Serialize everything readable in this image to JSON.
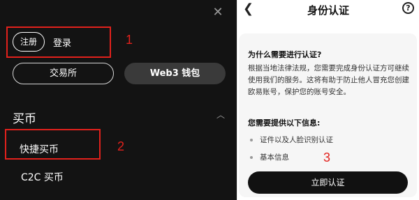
{
  "left_panel": {
    "close_glyph": "✕",
    "register_label": "注册",
    "login_label": "登录",
    "exchange_button": "交易所",
    "wallet_button": "Web3 钱包",
    "section_title": "买币",
    "chevron_glyph": "︿",
    "menu_items": [
      "快捷买币",
      "C2C 买币"
    ]
  },
  "annotations": [
    "1",
    "2",
    "3"
  ],
  "right_panel": {
    "back_glyph": "❮",
    "title": "身份认证",
    "help_glyph": "?",
    "question_title": "为什么需要进行认证?",
    "question_body": "根据当地法律法规，您需要完成身份认证方可继续使用我们的服务。这将有助于防止他人冒充您创建欧易账号，保护您的账号安全。",
    "info_title": "您需要提供以下信息:",
    "info_items": [
      "证件以及人脸识别认证",
      "基本信息"
    ],
    "cta_label": "立即认证"
  },
  "colors": {
    "annotation_red": "#e2211c",
    "dark_bg": "#131313",
    "cta_bg": "#111111"
  }
}
